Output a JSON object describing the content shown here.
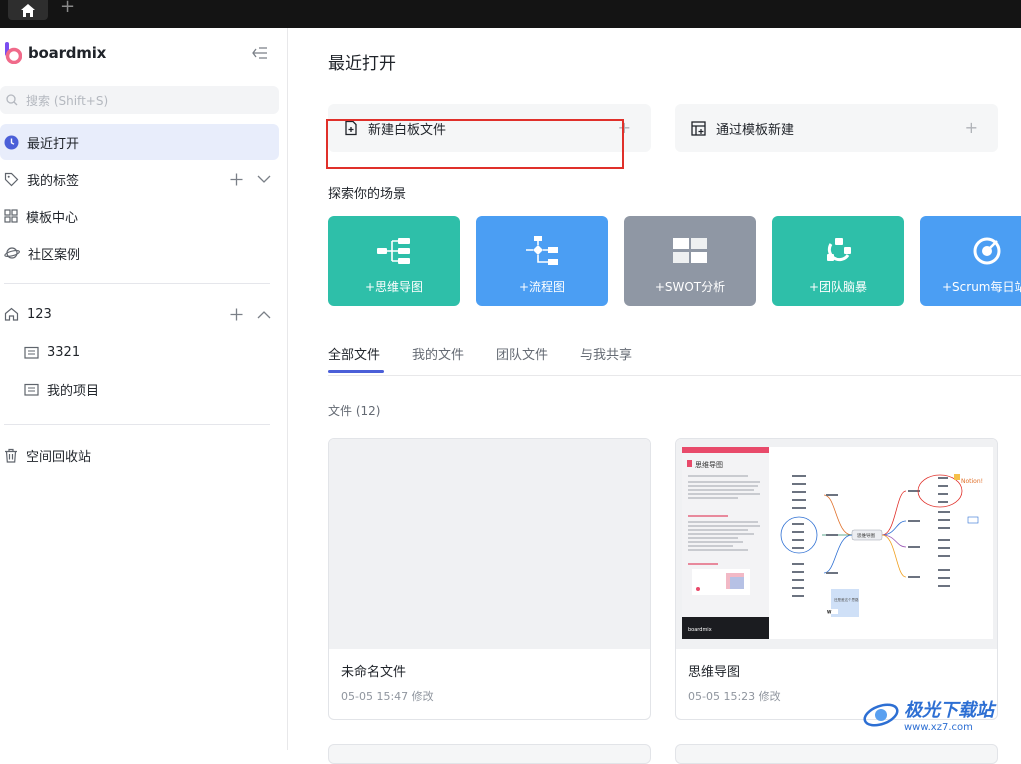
{
  "topbar": {
    "home_icon": "home-icon",
    "new_tab": "+"
  },
  "sidebar": {
    "brand": "boardmix",
    "search_placeholder": "搜索 (Shift+S)",
    "nav": [
      {
        "label": "最近打开",
        "icon": "clock-icon",
        "active": true
      },
      {
        "label": "我的标签",
        "icon": "tag-icon"
      },
      {
        "label": "模板中心",
        "icon": "grid-icon"
      },
      {
        "label": "社区案例",
        "icon": "planet-icon"
      }
    ],
    "workspace": {
      "label": "123",
      "icon": "home-outline-icon"
    },
    "projects": [
      {
        "label": "3321",
        "icon": "folder-icon"
      },
      {
        "label": "我的项目",
        "icon": "folder-icon"
      }
    ],
    "trash": {
      "label": "空间回收站",
      "icon": "trash-icon"
    }
  },
  "main": {
    "title": "最近打开",
    "create_whiteboard": "新建白板文件",
    "create_from_template": "通过模板新建",
    "scenes_label": "探索你的场景",
    "scenes": [
      {
        "label": "+思维导图",
        "color": "#2ebfa9",
        "icon": "mindmap-icon"
      },
      {
        "label": "+流程图",
        "color": "#4b9ef3",
        "icon": "flowchart-icon"
      },
      {
        "label": "+SWOT分析",
        "color": "#8f97a4",
        "icon": "swot-icon"
      },
      {
        "label": "+团队脑暴",
        "color": "#2ebfa9",
        "icon": "brainstorm-icon"
      },
      {
        "label": "+Scrum每日站",
        "color": "#4b9ef3",
        "icon": "scrum-icon"
      }
    ],
    "tabs": [
      "全部文件",
      "我的文件",
      "团队文件",
      "与我共享"
    ],
    "file_count": "文件 (12)",
    "files": [
      {
        "name": "未命名文件",
        "date": "05-05 15:47 修改"
      },
      {
        "name": "思维导图",
        "date": "05-05 15:23 修改"
      }
    ],
    "thumb": {
      "doc_title": "思维导图",
      "center_node": "思维导图",
      "notion_tag": "Notion!",
      "brand": "boardmix",
      "box_text": "还是差这个思路"
    }
  },
  "watermark": {
    "title": "极光下载站",
    "url": "www.xz7.com"
  }
}
